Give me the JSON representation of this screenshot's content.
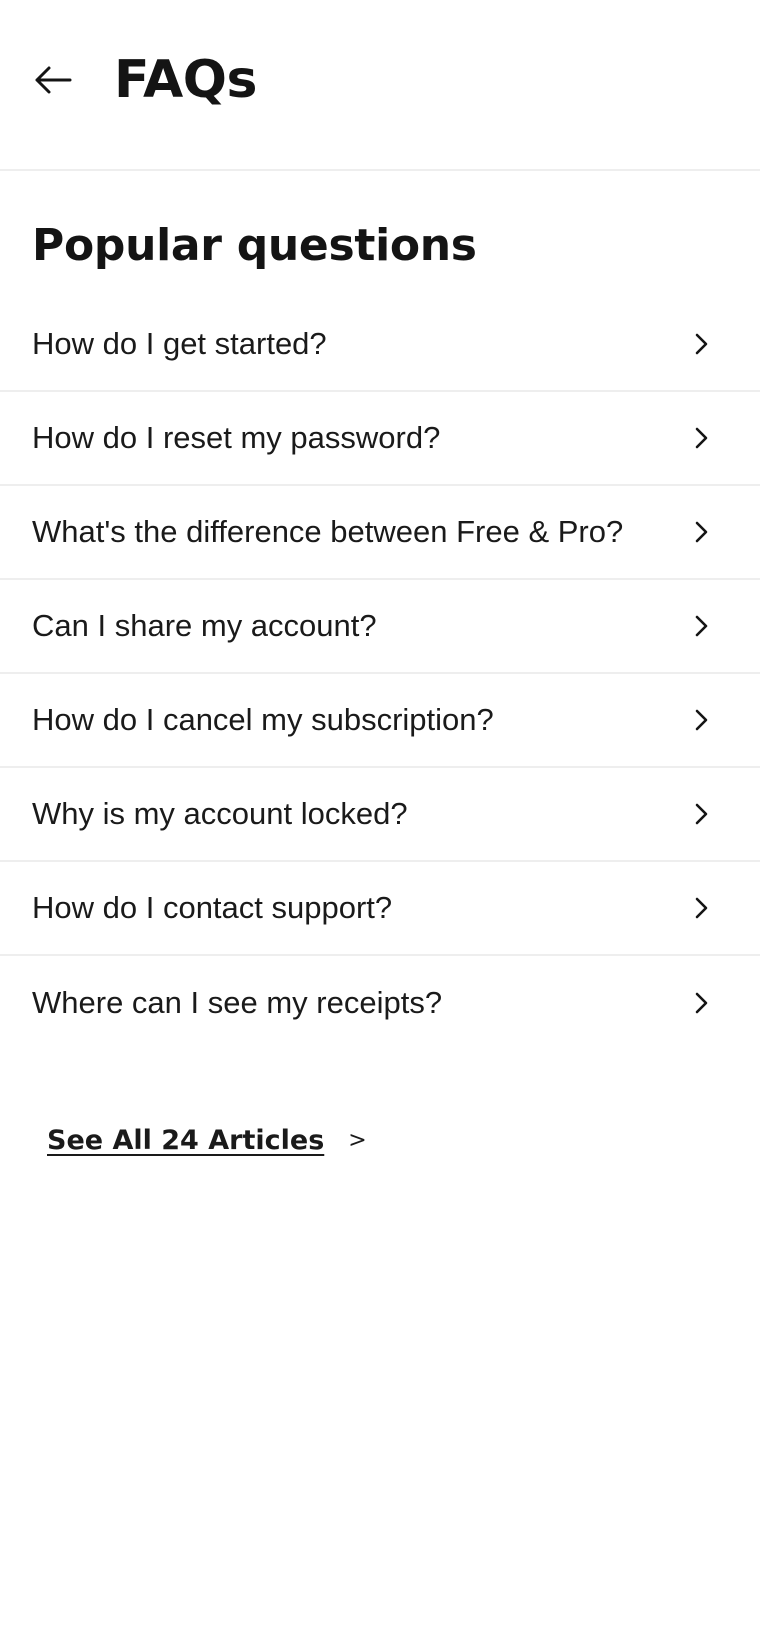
{
  "header": {
    "title": "FAQs",
    "back_icon": "arrow-left-icon"
  },
  "section": {
    "title": "Popular questions"
  },
  "questions": [
    {
      "label": "How do I get started?"
    },
    {
      "label": "How do I reset my password?"
    },
    {
      "label": "What's the difference between Free & Pro?"
    },
    {
      "label": "Can I share my account?"
    },
    {
      "label": "How do I cancel my subscription?"
    },
    {
      "label": "Why is my account locked?"
    },
    {
      "label": "How do I contact support?"
    },
    {
      "label": "Where can I see my receipts?"
    }
  ],
  "see_all": {
    "label": "See All 24 Articles",
    "arrow": ">"
  },
  "colors": {
    "text": "#141414",
    "divider": "#eeeeee",
    "background": "#ffffff"
  }
}
